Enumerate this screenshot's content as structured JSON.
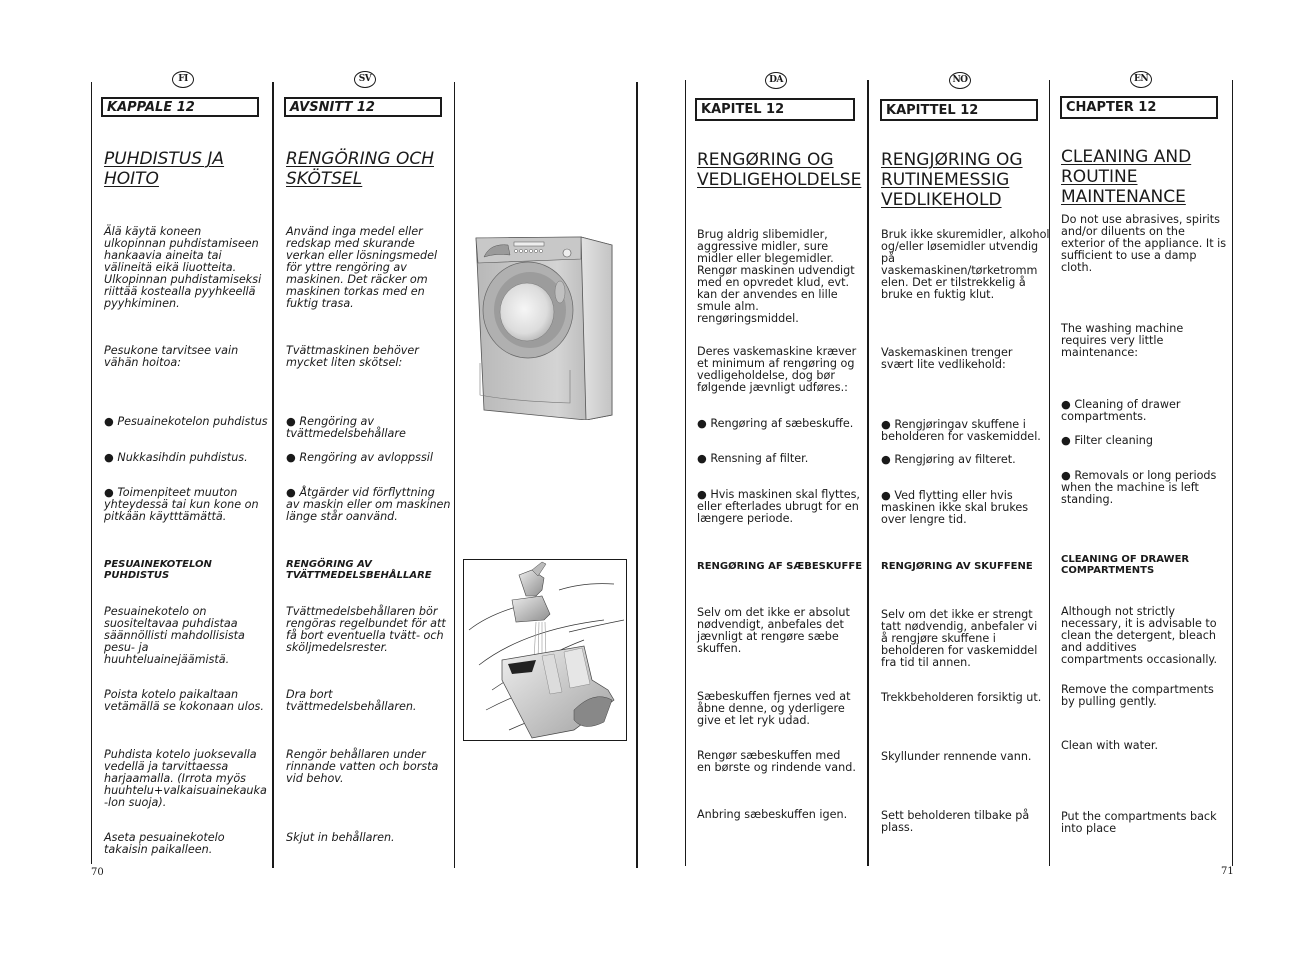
{
  "pages": {
    "left_page_number": "70",
    "right_page_number": "71"
  },
  "columns": {
    "fi": {
      "lang_badge": "FI",
      "chapter": "KAPPALE 12",
      "title_line1": "PUHDISTUS JA",
      "title_line2": "HOITO",
      "intro": [
        "Älä käytä koneen",
        "ulkopinnan puhdistamiseen",
        "hankaavia aineita tai",
        "välineitä eikä liuotteita.",
        "Ulkopinnan puhdistamiseksi",
        "riittää kostealla pyyhkeellä",
        "pyyhkiminen."
      ],
      "maintenance": [
        "Pesukone tarvitsee vain",
        "vähän hoitoa:"
      ],
      "bullet1": [
        "Pesuainekotelon puhdistus"
      ],
      "bullet2": [
        "Nukkasihdin puhdistus."
      ],
      "bullet3": [
        "Toimenpiteet muuton",
        "yhteydessä tai kun kone on",
        "pitkään käytttämättä."
      ],
      "subheading": [
        "PESUAINEKOTELON",
        "PUHDISTUS"
      ],
      "step1": [
        "Pesuainekotelo on",
        "suositeltavaa puhdistaa",
        "säännöllisti mahdollisista",
        "pesu- ja",
        "huuhteluainejäämistä."
      ],
      "step2": [
        "Poista kotelo paikaltaan",
        "vetämällä se kokonaan ulos."
      ],
      "step3": [
        "Puhdista kotelo juoksevalla",
        "vedellä ja tarvittaessa",
        "harjaamalla. (Irrota myös",
        "huuhtelu+valkaisuainekauka",
        "-lon suoja)."
      ],
      "step4": [
        "Aseta pesuainekotelo",
        "takaisin paikalleen."
      ]
    },
    "sv": {
      "lang_badge": "SV",
      "chapter": "AVSNITT 12",
      "title_line1": "RENGÖRING OCH",
      "title_line2": "SKÖTSEL",
      "intro": [
        "Använd inga medel eller",
        "redskap med skurande",
        "verkan eller lösningsmedel",
        "för yttre rengöring av",
        "maskinen. Det räcker om",
        "maskinen torkas med en",
        "fuktig trasa."
      ],
      "maintenance": [
        "Tvättmaskinen behöver",
        "mycket liten skötsel:"
      ],
      "bullet1": [
        "Rengöring av",
        "tvättmedelsbehållare"
      ],
      "bullet2": [
        "Rengöring av avloppssil"
      ],
      "bullet3": [
        "Åtgärder vid förflyttning",
        "av maskin eller om maskinen",
        "länge står oanvänd."
      ],
      "subheading": [
        "RENGÖRING AV",
        "TVÄTTMEDELSBEHÅLLARE"
      ],
      "step1": [
        "Tvättmedelsbehållaren bör",
        "rengöras regelbundet för att",
        "få bort eventuella tvätt- och",
        "sköljmedelsrester."
      ],
      "step2": [
        "Dra bort",
        "tvättmedelsbehållaren."
      ],
      "step3": [
        "Rengör behållaren under",
        "rinnande vatten och borsta",
        "vid behov."
      ],
      "step4": [
        "Skjut in behållaren."
      ]
    },
    "da": {
      "lang_badge": "DA",
      "chapter": "KAPITEL 12",
      "title_line1": "RENGØRING OG",
      "title_line2": "VEDLIGEHOLDELSE",
      "intro": [
        "Brug aldrig slibemidler,",
        "aggressive midler, sure",
        "midler eller blegemidler.",
        "Rengør maskinen udvendigt",
        "med en opvredet klud, evt.",
        "kan der anvendes en lille",
        "smule alm.",
        "rengøringsmiddel."
      ],
      "maintenance": [
        "Deres vaskemaskine kræver",
        "et minimum af rengøring og",
        "vedligeholdelse, dog bør",
        "følgende jævnligt udføres.:"
      ],
      "bullet1": [
        "Rengøring af sæbeskuffe."
      ],
      "bullet2": [
        "Rensning af filter."
      ],
      "bullet3": [
        "Hvis maskinen skal flyttes,",
        "eller efterlades ubrugt for en",
        "længere periode."
      ],
      "subheading": [
        "RENGØRING AF SÆBESKUFFE"
      ],
      "step1": [
        "Selv om det ikke er absolut",
        "nødvendigt, anbefales det",
        "jævnligt at rengøre sæbe",
        "skuffen."
      ],
      "step2": [
        "Sæbeskuffen fjernes ved at",
        "åbne denne, og yderligere",
        "give et let ryk udad."
      ],
      "step3": [
        "Rengør sæbeskuffen med",
        "en børste og rindende vand."
      ],
      "step4": [
        "Anbring sæbeskuffen igen."
      ]
    },
    "no": {
      "lang_badge": "NO",
      "chapter": "KAPITTEL 12",
      "title_line1": "RENGJØRING OG",
      "title_line2": "RUTINEMESSIG",
      "title_line3": "VEDLIKEHOLD",
      "intro": [
        "Bruk ikke skuremidler, alkohol",
        "og/eller løsemidler utvendig",
        "på",
        "vaskemaskinen/tørketromm",
        "elen. Det er tilstrekkelig å",
        "bruke en fuktig klut."
      ],
      "maintenance": [
        "Vaskemaskinen trenger",
        "svært lite vedlikehold:"
      ],
      "bullet1": [
        "Rengjøringav skuffene i",
        "beholderen for vaskemiddel."
      ],
      "bullet2": [
        "Rengjøring av filteret."
      ],
      "bullet3": [
        "Ved flytting eller hvis",
        "maskinen ikke skal brukes",
        "over lengre tid."
      ],
      "subheading": [
        "RENGJØRING AV SKUFFENE"
      ],
      "step1": [
        "Selv om det ikke er strengt",
        "tatt nødvendig, anbefaler vi",
        "å rengjøre skuffene i",
        "beholderen for vaskemiddel",
        "fra tid til annen."
      ],
      "step2": [
        "Trekkbeholderen forsiktig ut."
      ],
      "step3": [
        "Skyllunder rennende vann."
      ],
      "step4": [
        "Sett beholderen tilbake på",
        "plass."
      ]
    },
    "en": {
      "lang_badge": "EN",
      "chapter": "CHAPTER 12",
      "title_line1": "CLEANING AND",
      "title_line2": "ROUTINE",
      "title_line3": "MAINTENANCE",
      "intro": [
        "Do not use abrasives, spirits",
        "and/or diluents on the",
        "exterior of the appliance. It is",
        "sufficient to use a damp",
        "cloth."
      ],
      "maintenance": [
        "The washing machine",
        "requires very little",
        "maintenance:"
      ],
      "bullet1": [
        "Cleaning of drawer",
        "compartments."
      ],
      "bullet2": [
        "Filter cleaning"
      ],
      "bullet3": [
        "Removals or long periods",
        "when the machine is left",
        "standing."
      ],
      "subheading": [
        "CLEANING OF DRAWER",
        "COMPARTMENTS"
      ],
      "step1": [
        "Although not strictly",
        "necessary, it is advisable to",
        "clean the detergent, bleach",
        "and additives",
        "compartments occasionally."
      ],
      "step2": [
        "Remove the compartments",
        "by pulling gently."
      ],
      "step3": [
        "Clean with water."
      ],
      "step4": [
        "Put the compartments back",
        "into place"
      ]
    }
  },
  "illustrations": {
    "washing_machine": "washing-machine-illustration",
    "drawer_under_tap": "detergent-drawer-under-tap-illustration"
  }
}
